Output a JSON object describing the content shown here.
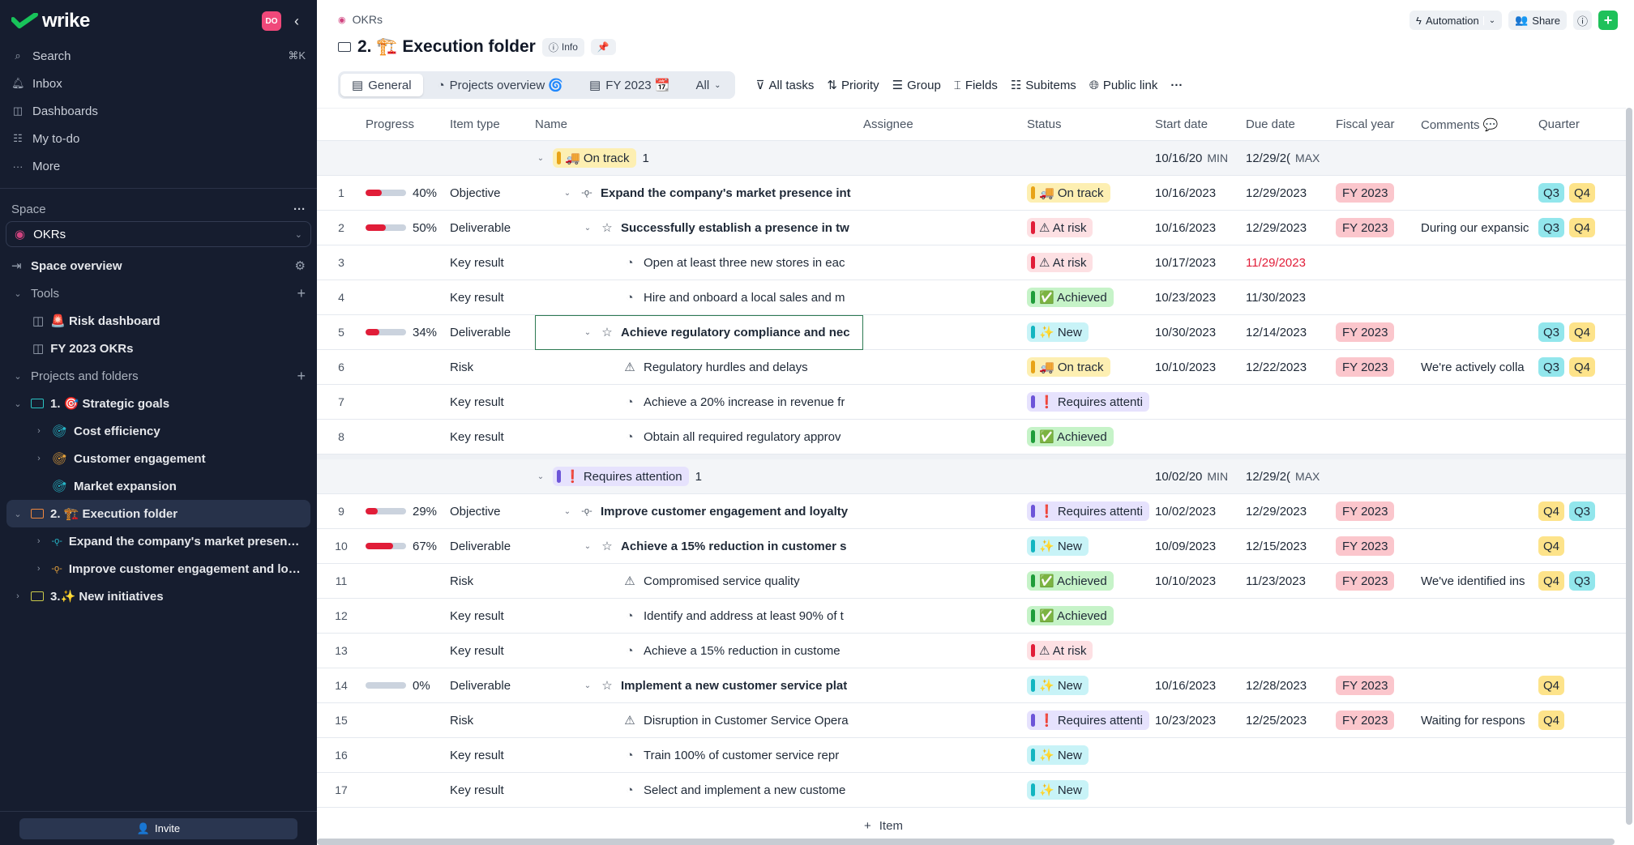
{
  "sidebar": {
    "logo": "wrike",
    "avatar": "DO",
    "nav": [
      {
        "label": "Search",
        "icon": "search-icon",
        "shortcut": "⌘K"
      },
      {
        "label": "Inbox",
        "icon": "bell-icon"
      },
      {
        "label": "Dashboards",
        "icon": "dashboard-icon"
      },
      {
        "label": "My to-do",
        "icon": "todo-icon"
      },
      {
        "label": "More",
        "icon": "more-icon"
      }
    ],
    "space_label": "Space",
    "space_name": "OKRs",
    "space_overview": "Space overview",
    "tools_label": "Tools",
    "tools": [
      "🚨 Risk dashboard",
      "FY 2023 OKRs"
    ],
    "projects_label": "Projects and folders",
    "tree": [
      {
        "label": "1. 🎯 Strategic goals",
        "color": "#2ac3c3"
      },
      {
        "label": "Cost efficiency",
        "color": "#27b7c9"
      },
      {
        "label": "Customer engagement",
        "color": "#e6a23c"
      },
      {
        "label": "Market expansion",
        "color": "#27b7c9"
      },
      {
        "label": "2. 🏗️ Execution folder",
        "color": "#f0883e"
      },
      {
        "label": "Expand the company's market presence ...",
        "color": "#27b7c9"
      },
      {
        "label": "Improve customer engagement and loyal...",
        "color": "#e6a23c"
      },
      {
        "label": "3.✨ New initiatives",
        "color": "#c9c94a"
      }
    ],
    "invite": "Invite"
  },
  "header": {
    "breadcrumb": "OKRs",
    "title": "2. 🏗️ Execution folder",
    "info": "Info",
    "automation": "Automation",
    "share": "Share"
  },
  "views": {
    "tabs": [
      "General",
      "Projects overview 🌀",
      "FY 2023 📆",
      "All"
    ],
    "tools": [
      "All tasks",
      "Priority",
      "Group",
      "Fields",
      "Subitems",
      "Public link"
    ]
  },
  "columns": [
    "Progress",
    "Item type",
    "Name",
    "Assignee",
    "Status",
    "Start date",
    "Due date",
    "Fiscal year",
    "Comments 💬",
    "Quarter"
  ],
  "statuses": {
    "on_track": {
      "label": "🚚 On track",
      "bg": "#fdefb2",
      "mark": "#e8a317"
    },
    "at_risk": {
      "label": "⚠ At risk",
      "bg": "#fde0e3",
      "mark": "#e11d38"
    },
    "achieved": {
      "label": "✅ Achieved",
      "bg": "#c6f3c8",
      "mark": "#1f9d3a"
    },
    "new": {
      "label": "✨ New",
      "bg": "#c8f3f7",
      "mark": "#13b5c0"
    },
    "attention": {
      "label": "❗ Requires attenti",
      "bg": "#e6e2fd",
      "mark": "#6d55d8"
    }
  },
  "groups": [
    {
      "label": "🚚 On track",
      "count": "1",
      "start_min": "10/16/20",
      "min": "MIN",
      "due_max": "12/29/2(",
      "max": "MAX",
      "rows": [
        {
          "n": "1",
          "progress": 40,
          "pct": "40%",
          "type": "Objective",
          "name": "Expand the company's market presence int",
          "icon": "objective",
          "bold": true,
          "indent": 1,
          "status": "on_track",
          "start": "10/16/2023",
          "due": "12/29/2023",
          "fy": "FY 2023",
          "comment": "",
          "q": [
            "Q3",
            "Q4"
          ]
        },
        {
          "n": "2",
          "progress": 50,
          "pct": "50%",
          "type": "Deliverable",
          "name": "Successfully establish a presence in tw",
          "icon": "star",
          "bold": true,
          "indent": 2,
          "status": "at_risk",
          "start": "10/16/2023",
          "due": "12/29/2023",
          "fy": "FY 2023",
          "comment": "During our expansic",
          "q": [
            "Q3",
            "Q4"
          ]
        },
        {
          "n": "3",
          "type": "Key result",
          "name": "Open at least three new stores in eac",
          "icon": "keyresult",
          "indent": 3,
          "status": "at_risk",
          "start": "10/17/2023",
          "due": "11/29/2023",
          "overdue": true,
          "q": []
        },
        {
          "n": "4",
          "type": "Key result",
          "name": "Hire and onboard a local sales and m",
          "icon": "keyresult",
          "indent": 3,
          "status": "achieved",
          "start": "10/23/2023",
          "due": "11/30/2023",
          "q": []
        },
        {
          "n": "5",
          "progress": 34,
          "pct": "34%",
          "type": "Deliverable",
          "name": "Achieve regulatory compliance and nec",
          "icon": "star",
          "bold": true,
          "indent": 2,
          "status": "new",
          "start": "10/30/2023",
          "due": "12/14/2023",
          "fy": "FY 2023",
          "q": [
            "Q3",
            "Q4"
          ],
          "selected": true
        },
        {
          "n": "6",
          "type": "Risk",
          "name": "Regulatory hurdles and delays",
          "icon": "risk",
          "indent": 3,
          "status": "on_track",
          "start": "10/10/2023",
          "due": "12/22/2023",
          "fy": "FY 2023",
          "comment": "We're actively colla",
          "q": [
            "Q3",
            "Q4"
          ]
        },
        {
          "n": "7",
          "type": "Key result",
          "name": "Achieve a 20% increase in revenue fr",
          "icon": "keyresult",
          "indent": 3,
          "status": "attention",
          "q": []
        },
        {
          "n": "8",
          "type": "Key result",
          "name": "Obtain all required regulatory approv",
          "icon": "keyresult",
          "indent": 3,
          "status": "achieved",
          "q": []
        }
      ]
    },
    {
      "label": "❗ Requires attention",
      "count": "1",
      "start_min": "10/02/20",
      "min": "MIN",
      "due_max": "12/29/2(",
      "max": "MAX",
      "rows": [
        {
          "n": "9",
          "progress": 29,
          "pct": "29%",
          "type": "Objective",
          "name": "Improve customer engagement and loyalty",
          "icon": "objective",
          "bold": true,
          "indent": 1,
          "status": "attention",
          "start": "10/02/2023",
          "due": "12/29/2023",
          "fy": "FY 2023",
          "q": [
            "Q4",
            "Q3"
          ]
        },
        {
          "n": "10",
          "progress": 67,
          "pct": "67%",
          "type": "Deliverable",
          "name": "Achieve a 15% reduction in customer s",
          "icon": "star",
          "bold": true,
          "indent": 2,
          "status": "new",
          "start": "10/09/2023",
          "due": "12/15/2023",
          "fy": "FY 2023",
          "q": [
            "Q4"
          ]
        },
        {
          "n": "11",
          "type": "Risk",
          "name": "Compromised service quality",
          "icon": "risk",
          "indent": 3,
          "status": "achieved",
          "start": "10/10/2023",
          "due": "11/23/2023",
          "fy": "FY 2023",
          "comment": "We've identified ins",
          "q": [
            "Q4",
            "Q3"
          ]
        },
        {
          "n": "12",
          "type": "Key result",
          "name": "Identify and address at least 90% of t",
          "icon": "keyresult",
          "indent": 3,
          "status": "achieved",
          "q": []
        },
        {
          "n": "13",
          "type": "Key result",
          "name": "Achieve a 15% reduction in custome",
          "icon": "keyresult",
          "indent": 3,
          "status": "at_risk",
          "q": []
        },
        {
          "n": "14",
          "progress": 0,
          "pct": "0%",
          "type": "Deliverable",
          "name": "Implement a new customer service plat",
          "icon": "star",
          "bold": true,
          "indent": 2,
          "status": "new",
          "start": "10/16/2023",
          "due": "12/28/2023",
          "fy": "FY 2023",
          "q": [
            "Q4"
          ]
        },
        {
          "n": "15",
          "type": "Risk",
          "name": "Disruption in Customer Service Opera",
          "icon": "risk",
          "indent": 3,
          "status": "attention",
          "start": "10/23/2023",
          "due": "12/25/2023",
          "fy": "FY 2023",
          "comment": "Waiting for respons",
          "q": [
            "Q4"
          ]
        },
        {
          "n": "16",
          "type": "Key result",
          "name": "Train 100% of customer service repr",
          "icon": "keyresult",
          "indent": 3,
          "status": "new",
          "q": []
        },
        {
          "n": "17",
          "type": "Key result",
          "name": "Select and implement a new custome",
          "icon": "keyresult",
          "indent": 3,
          "status": "new",
          "q": []
        }
      ]
    }
  ],
  "add_item": "Item"
}
